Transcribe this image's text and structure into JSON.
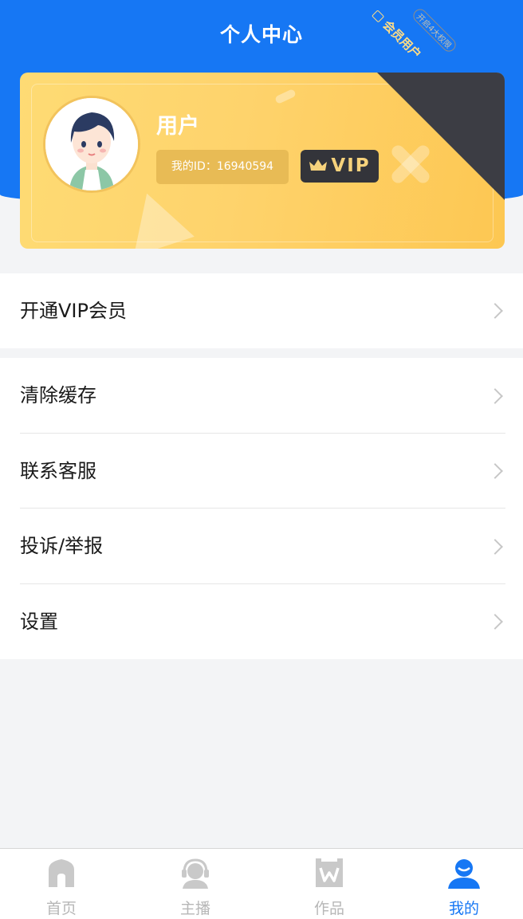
{
  "header": {
    "title": "个人中心"
  },
  "profile": {
    "username": "用户",
    "id_text": "我的ID：16940594",
    "vip_label": "VIP",
    "corner_label": "会员用户",
    "corner_badge": "开启4大权限"
  },
  "menu": [
    {
      "label": "开通VIP会员"
    },
    {
      "label": "清除缓存"
    },
    {
      "label": "联系客服"
    },
    {
      "label": "投诉/举报"
    },
    {
      "label": "设置"
    }
  ],
  "tabbar": {
    "tabs": [
      {
        "label": "首页",
        "icon": "home-icon"
      },
      {
        "label": "主播",
        "icon": "headset-icon"
      },
      {
        "label": "作品",
        "icon": "works-icon"
      },
      {
        "label": "我的",
        "icon": "user-icon",
        "active": true
      }
    ]
  },
  "colors": {
    "primary": "#1677f4",
    "vip_gold": "#fed36c",
    "vip_dark": "#33343a"
  }
}
